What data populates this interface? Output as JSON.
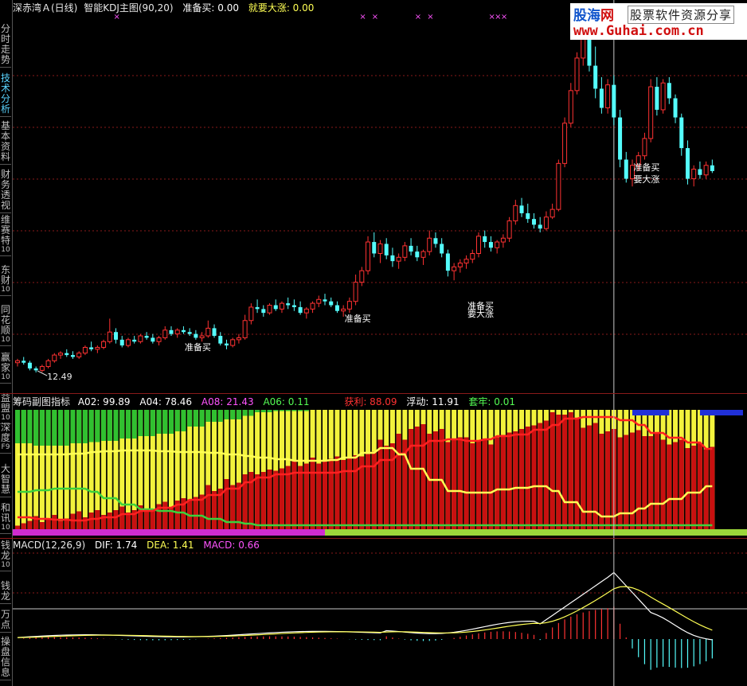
{
  "sidebar": [
    {
      "label": "分时走势",
      "num": ""
    },
    {
      "label": "技术分析",
      "num": "",
      "active": true
    },
    {
      "label": "基本资料",
      "num": ""
    },
    {
      "label": "财务透视",
      "num": ""
    },
    {
      "label": "维赛特",
      "num": "10"
    },
    {
      "label": "东财",
      "num": "10"
    },
    {
      "label": "同花顺",
      "num": "10"
    },
    {
      "label": "赢家",
      "num": "10"
    },
    {
      "label": "益盟",
      "num": "10"
    },
    {
      "label": "深度",
      "num": "F9"
    },
    {
      "label": "大智慧",
      "num": ""
    },
    {
      "label": "和讯",
      "num": "10"
    },
    {
      "label": "钱龙",
      "num": "10"
    },
    {
      "label": "钱龙",
      "num": ""
    },
    {
      "label": "万点",
      "num": ""
    },
    {
      "label": "操盘信息",
      "num": ""
    }
  ],
  "main": {
    "stock": "深赤湾Ａ(日线)",
    "indicator": "智能KDJ主图(90,20)",
    "buy_label": "准备买: 0.00",
    "surge_label": "就要大涨: 0.00",
    "low_price": "12.49",
    "annotations": [
      "准备买",
      "准备买",
      "准备买",
      "要大涨",
      "准备买",
      "要大涨"
    ]
  },
  "logo": {
    "brand_a": "股海",
    "brand_b": "网",
    "slogan": "股票软件资源分享",
    "url": "www.Guhai.com.cn"
  },
  "chip": {
    "title": "筹码副图指标",
    "a02": "A02: 99.89",
    "a04": "A04: 78.46",
    "a08": "A08: 21.43",
    "a06": "A06: 0.11",
    "profit": "获利: 88.09",
    "float": "浮动: 11.91",
    "trapped": "套牢: 0.01"
  },
  "macd": {
    "title": "MACD(12,26,9)",
    "dif": "DIF: 1.74",
    "dea": "DEA: 1.41",
    "macd": "MACD: 0.66"
  },
  "colors": {
    "up": "#ff3232",
    "down": "#54fcfc",
    "yellow": "#ffff54",
    "magenta": "#ff54ff",
    "chip_red": "#c81010",
    "chip_yellow": "#f2f23c",
    "chip_green": "#30c030",
    "grid": "#8a1a1a"
  },
  "candles": [
    [
      13.0,
      13.2,
      12.8,
      13.1
    ],
    [
      13.1,
      13.3,
      12.9,
      13.0
    ],
    [
      13.0,
      13.1,
      12.6,
      12.7
    ],
    [
      12.7,
      12.8,
      12.49,
      12.6
    ],
    [
      12.6,
      12.9,
      12.5,
      12.8
    ],
    [
      12.8,
      13.2,
      12.7,
      13.1
    ],
    [
      13.1,
      13.5,
      13.0,
      13.4
    ],
    [
      13.4,
      13.6,
      13.2,
      13.5
    ],
    [
      13.5,
      13.7,
      13.3,
      13.4
    ],
    [
      13.4,
      13.6,
      13.2,
      13.3
    ],
    [
      13.3,
      13.6,
      13.2,
      13.5
    ],
    [
      13.5,
      13.9,
      13.4,
      13.8
    ],
    [
      13.8,
      14.1,
      13.6,
      13.7
    ],
    [
      13.7,
      13.9,
      13.5,
      13.8
    ],
    [
      13.8,
      14.2,
      13.7,
      14.1
    ],
    [
      14.1,
      15.3,
      14.0,
      14.6
    ],
    [
      14.6,
      14.8,
      14.0,
      14.2
    ],
    [
      14.2,
      14.4,
      13.8,
      13.9
    ],
    [
      13.9,
      14.3,
      13.8,
      14.2
    ],
    [
      14.2,
      14.4,
      14.0,
      14.1
    ],
    [
      14.1,
      14.5,
      14.0,
      14.4
    ],
    [
      14.4,
      14.6,
      14.2,
      14.3
    ],
    [
      14.3,
      14.5,
      14.0,
      14.1
    ],
    [
      14.1,
      14.4,
      13.9,
      14.3
    ],
    [
      14.3,
      14.9,
      14.2,
      14.7
    ],
    [
      14.7,
      14.9,
      14.4,
      14.5
    ],
    [
      14.5,
      14.8,
      14.3,
      14.7
    ],
    [
      14.7,
      14.9,
      14.5,
      14.6
    ],
    [
      14.6,
      14.8,
      14.4,
      14.5
    ],
    [
      14.5,
      14.7,
      14.2,
      14.3
    ],
    [
      14.3,
      14.6,
      14.1,
      14.4
    ],
    [
      14.4,
      15.2,
      14.3,
      14.8
    ],
    [
      14.8,
      15.0,
      14.3,
      14.4
    ],
    [
      14.4,
      14.6,
      13.9,
      14.0
    ],
    [
      14.0,
      14.2,
      13.7,
      13.9
    ],
    [
      13.9,
      14.3,
      13.8,
      14.2
    ],
    [
      14.2,
      14.5,
      14.0,
      14.3
    ],
    [
      14.3,
      15.5,
      14.2,
      15.2
    ],
    [
      15.2,
      16.1,
      15.0,
      15.9
    ],
    [
      15.9,
      16.3,
      15.6,
      15.8
    ],
    [
      15.8,
      16.0,
      15.4,
      15.6
    ],
    [
      15.6,
      16.1,
      15.5,
      16.0
    ],
    [
      16.0,
      16.3,
      15.7,
      15.8
    ],
    [
      15.8,
      16.2,
      15.6,
      16.1
    ],
    [
      16.1,
      16.4,
      15.8,
      16.0
    ],
    [
      16.0,
      16.3,
      15.7,
      15.9
    ],
    [
      15.9,
      16.2,
      15.5,
      15.6
    ],
    [
      15.6,
      15.9,
      15.3,
      15.8
    ],
    [
      15.8,
      16.2,
      15.6,
      16.1
    ],
    [
      16.1,
      16.5,
      15.9,
      16.3
    ],
    [
      16.3,
      16.6,
      16.0,
      16.2
    ],
    [
      16.2,
      16.4,
      15.9,
      16.0
    ],
    [
      16.0,
      16.2,
      15.6,
      15.7
    ],
    [
      15.7,
      16.0,
      15.4,
      15.8
    ],
    [
      15.8,
      16.4,
      15.6,
      16.2
    ],
    [
      16.2,
      17.6,
      16.0,
      17.2
    ],
    [
      17.2,
      18.0,
      17.0,
      17.8
    ],
    [
      17.8,
      19.6,
      17.6,
      19.3
    ],
    [
      19.3,
      19.8,
      18.5,
      18.7
    ],
    [
      18.7,
      19.4,
      18.2,
      19.2
    ],
    [
      19.2,
      19.5,
      18.4,
      18.6
    ],
    [
      18.6,
      19.0,
      18.0,
      18.3
    ],
    [
      18.3,
      18.7,
      17.9,
      18.5
    ],
    [
      18.5,
      19.3,
      18.3,
      19.1
    ],
    [
      19.1,
      19.5,
      18.6,
      18.8
    ],
    [
      18.8,
      19.1,
      18.3,
      18.5
    ],
    [
      18.5,
      18.9,
      18.1,
      18.8
    ],
    [
      18.8,
      19.9,
      18.6,
      19.5
    ],
    [
      19.5,
      19.8,
      19.0,
      19.2
    ],
    [
      19.2,
      19.5,
      18.5,
      18.7
    ],
    [
      18.7,
      18.9,
      17.5,
      17.8
    ],
    [
      17.8,
      18.2,
      17.3,
      18.0
    ],
    [
      18.0,
      18.4,
      17.7,
      18.2
    ],
    [
      18.2,
      18.6,
      17.9,
      18.4
    ],
    [
      18.4,
      18.9,
      18.2,
      18.7
    ],
    [
      18.7,
      19.8,
      18.5,
      19.6
    ],
    [
      19.6,
      19.9,
      19.0,
      19.3
    ],
    [
      19.3,
      19.6,
      18.8,
      19.0
    ],
    [
      19.0,
      19.4,
      18.7,
      19.3
    ],
    [
      19.3,
      19.7,
      19.0,
      19.5
    ],
    [
      19.5,
      20.6,
      19.3,
      20.4
    ],
    [
      20.4,
      21.5,
      20.2,
      21.2
    ],
    [
      21.2,
      21.6,
      20.6,
      20.8
    ],
    [
      20.8,
      21.3,
      20.3,
      20.5
    ],
    [
      20.5,
      20.8,
      20.0,
      20.2
    ],
    [
      20.2,
      20.6,
      19.8,
      20.0
    ],
    [
      20.0,
      20.9,
      19.9,
      20.6
    ],
    [
      20.6,
      21.3,
      20.5,
      21.0
    ],
    [
      21.0,
      23.6,
      20.9,
      23.4
    ],
    [
      23.4,
      25.8,
      23.2,
      25.5
    ],
    [
      25.5,
      27.6,
      25.3,
      27.2
    ],
    [
      27.2,
      29.2,
      27.0,
      28.9
    ],
    [
      28.9,
      31.2,
      28.5,
      30.2
    ],
    [
      30.2,
      30.8,
      28.2,
      28.5
    ],
    [
      28.5,
      29.5,
      26.8,
      27.3
    ],
    [
      27.3,
      27.9,
      26.0,
      26.3
    ],
    [
      26.3,
      27.8,
      26.0,
      27.5
    ],
    [
      27.5,
      28.0,
      25.4,
      25.8
    ],
    [
      25.8,
      26.2,
      23.2,
      23.6
    ],
    [
      23.6,
      24.0,
      22.4,
      22.6
    ],
    [
      22.6,
      23.6,
      22.2,
      23.3
    ],
    [
      23.3,
      24.0,
      23.0,
      23.8
    ],
    [
      23.8,
      25.0,
      23.6,
      24.7
    ],
    [
      24.7,
      27.8,
      24.5,
      27.4
    ],
    [
      27.4,
      27.9,
      25.9,
      26.2
    ],
    [
      26.2,
      27.8,
      26.0,
      27.6
    ],
    [
      27.6,
      27.9,
      26.5,
      26.8
    ],
    [
      26.8,
      27.0,
      25.5,
      25.8
    ],
    [
      25.8,
      26.0,
      23.8,
      24.2
    ],
    [
      24.2,
      24.6,
      22.3,
      22.6
    ],
    [
      22.6,
      23.3,
      22.2,
      23.1
    ],
    [
      23.1,
      23.5,
      22.6,
      22.8
    ],
    [
      22.8,
      23.5,
      22.6,
      23.3
    ],
    [
      23.3,
      23.6,
      22.9,
      23.0
    ]
  ],
  "marker_cols": [
    16,
    56,
    58,
    65,
    67,
    77,
    78,
    79
  ]
}
